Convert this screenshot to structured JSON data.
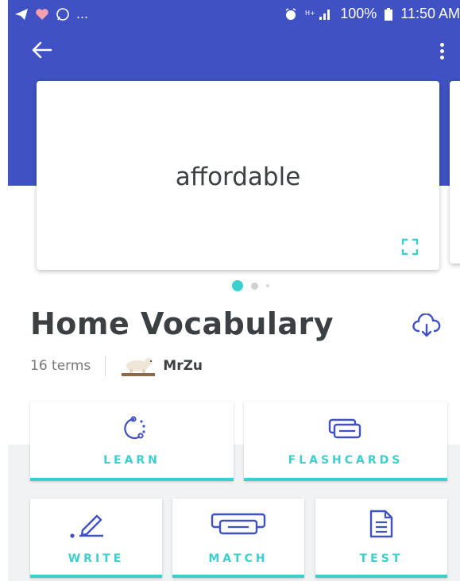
{
  "status_bar": {
    "left_ellipsis": "...",
    "battery": "100%",
    "time": "11:50 AM"
  },
  "card": {
    "term": "affordable"
  },
  "pager": {
    "pages": 3,
    "active_index": 0
  },
  "set": {
    "title": "Home Vocabulary",
    "terms_count": "16 terms",
    "author": "MrZu"
  },
  "modes": {
    "learn": "LEARN",
    "flashcards": "FLASHCARDS",
    "write": "WRITE",
    "match": "MATCH",
    "test": "TEST"
  },
  "colors": {
    "brand_blue": "#3f51c3",
    "accent_teal": "#3ccfcf",
    "text_dark": "#3c4042"
  },
  "icons": {
    "back": "arrow-left-icon",
    "menu": "more-vert-icon",
    "expand": "fullscreen-icon",
    "download": "cloud-download-icon",
    "learn": "learn-dots-icon",
    "flashcards": "flashcards-icon",
    "write": "pencil-icon",
    "match": "match-cards-icon",
    "test": "test-document-icon"
  }
}
